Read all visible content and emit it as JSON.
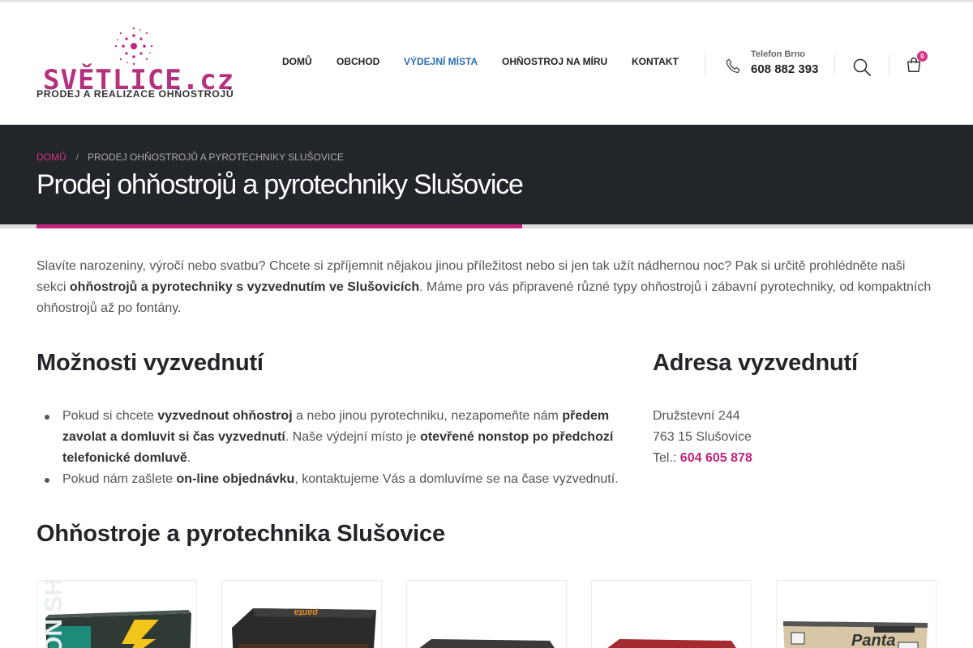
{
  "header": {
    "logo_text": "SVĚTLICE.cz",
    "logo_tagline": "PRODEJ A REALIZACE OHŇOSTROJŮ",
    "nav": [
      {
        "label": "DOMŮ",
        "active": false
      },
      {
        "label": "OBCHOD",
        "active": false
      },
      {
        "label": "VÝDEJNÍ MÍSTA",
        "active": true
      },
      {
        "label": "OHŇOSTROJ NA MÍRU",
        "active": false
      },
      {
        "label": "KONTAKT",
        "active": false
      }
    ],
    "phone_label": "Telefon Brno",
    "phone_number": "608 882 393",
    "cart_count": "0"
  },
  "breadcrumb": {
    "home": "DOMŮ",
    "separator": "/",
    "current": "PRODEJ OHŇOSTROJŮ A PYROTECHNIKY SLUŠOVICE"
  },
  "page_title": "Prodej ohňostrojů a pyrotechniky Slušovice",
  "intro": {
    "part1": "Slavíte narozeniny, výročí nebo svatbu? Chcete si zpříjemnit nějakou jinou příležitost nebo si jen tak užít nádhernou noc? Pak si určitě prohlédněte naši sekci ",
    "bold1": "ohňostrojů a pyrotechniky s vyzvednutím ve Slušovicích",
    "part2": ". Máme pro vás připravené různé typy ohňostrojů i zábavní pyrotechniky, od kompaktních ohňostrojů až po fontány."
  },
  "pickup_options": {
    "heading": "Možnosti vyzvednutí",
    "item1": {
      "t1": "Pokud si chcete ",
      "b1": "vyzvednout ohňostroj",
      "t2": " a nebo jinou pyrotechniku, nezapomeňte nám ",
      "b2": "předem zavolat a domluvit si čas vyzvednutí",
      "t3": ". Naše výdejní místo je ",
      "b3": "otevřené nonstop po předchozí telefonické domluvě",
      "t4": "."
    },
    "item2": {
      "t1": "Pokud nám zašlete ",
      "b1": "on-line objednávku",
      "t2": ", kontaktujeme Vás a domluvíme se na čase vyzvednutí."
    }
  },
  "pickup_address": {
    "heading": "Adresa vyzvednutí",
    "street": "Družstevní 244",
    "city": "763 15 Slušovice",
    "tel_label": "Tel.: ",
    "tel": "604 605 878"
  },
  "products": {
    "heading": "Ohňostroje a pyrotechnika Slušovice",
    "cards": [
      {
        "image": "fireworks-box-green",
        "label": "ON SHOTS"
      },
      {
        "image": "fireworks-box-dark",
        "label": "panta"
      },
      {
        "image": "fireworks-box-grey",
        "label": ""
      },
      {
        "image": "fireworks-box-red",
        "label": ""
      },
      {
        "image": "fireworks-box-panta",
        "label": "Panta"
      }
    ]
  },
  "colors": {
    "accent": "#c3237d",
    "nav_active": "#2a6db3",
    "hero_bg": "#222529"
  }
}
